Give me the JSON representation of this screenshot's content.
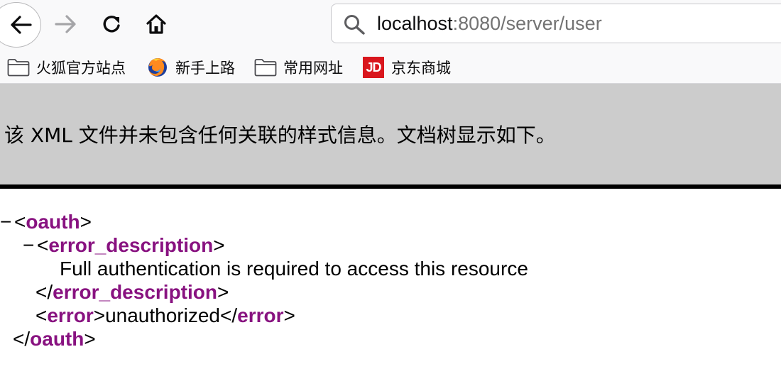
{
  "browser": {
    "url_host": "localhost",
    "url_path": ":8080/server/user",
    "icons": {
      "back": "arrow-left-icon",
      "forward": "arrow-right-icon",
      "reload": "reload-icon",
      "home": "home-icon",
      "search": "search-icon"
    }
  },
  "bookmarks": [
    {
      "label": "火狐官方站点",
      "icon": "folder-icon"
    },
    {
      "label": "新手上路",
      "icon": "firefox-icon"
    },
    {
      "label": "常用网址",
      "icon": "folder-icon"
    },
    {
      "label": "京东商城",
      "icon": "jd-icon",
      "icon_text": "JD"
    }
  ],
  "xml_viewer": {
    "info_message": "该 XML 文件并未包含任何关联的样式信息。文档树显示如下。",
    "collapser": "−",
    "tags": {
      "root": "oauth",
      "error_description": "error_description",
      "error": "error"
    },
    "values": {
      "error_description": "Full authentication is required to access this resource",
      "error": "unauthorized"
    }
  },
  "colors": {
    "tag_name": "#881280",
    "banner_bg": "#cccccc",
    "jd_red": "#d9161d"
  }
}
